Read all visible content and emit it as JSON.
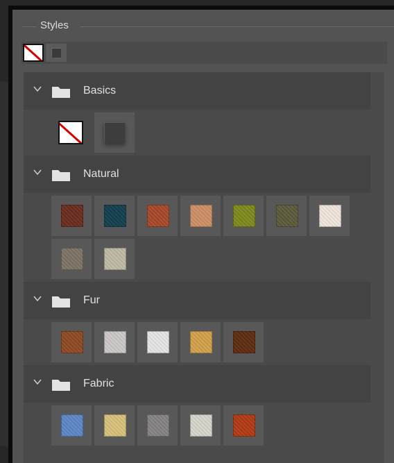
{
  "panel": {
    "title": "Styles"
  },
  "recent": {
    "items": [
      {
        "icon": "no-style-icon"
      },
      {
        "icon": "default-style-icon"
      }
    ]
  },
  "groups": [
    {
      "label": "Basics",
      "expanded": true,
      "swatches": [
        {
          "name": "No Style",
          "icon": "no-style-icon"
        },
        {
          "name": "Default Style",
          "icon": "default-style-icon"
        }
      ]
    },
    {
      "label": "Natural",
      "expanded": true,
      "swatches": [
        {
          "color": "#6a2c1c"
        },
        {
          "color": "#123f4d"
        },
        {
          "color": "#a8482a"
        },
        {
          "color": "#cf9066"
        },
        {
          "color": "#7f8a1c"
        },
        {
          "color": "#5c5a3c"
        },
        {
          "color": "#f0e6dc"
        },
        {
          "color": "#7d7466"
        },
        {
          "color": "#bfbba6"
        }
      ]
    },
    {
      "label": "Fur",
      "expanded": true,
      "swatches": [
        {
          "color": "#8f4a22"
        },
        {
          "color": "#cdc9c9"
        },
        {
          "color": "#e6e6e6"
        },
        {
          "color": "#d4a24a"
        },
        {
          "color": "#5e2c10"
        }
      ]
    },
    {
      "label": "Fabric",
      "expanded": true,
      "swatches": [
        {
          "color": "#5c88c6"
        },
        {
          "color": "#d8c27a"
        },
        {
          "color": "#858383"
        },
        {
          "color": "#d6d6cc"
        },
        {
          "color": "#b23a14"
        }
      ]
    }
  ]
}
